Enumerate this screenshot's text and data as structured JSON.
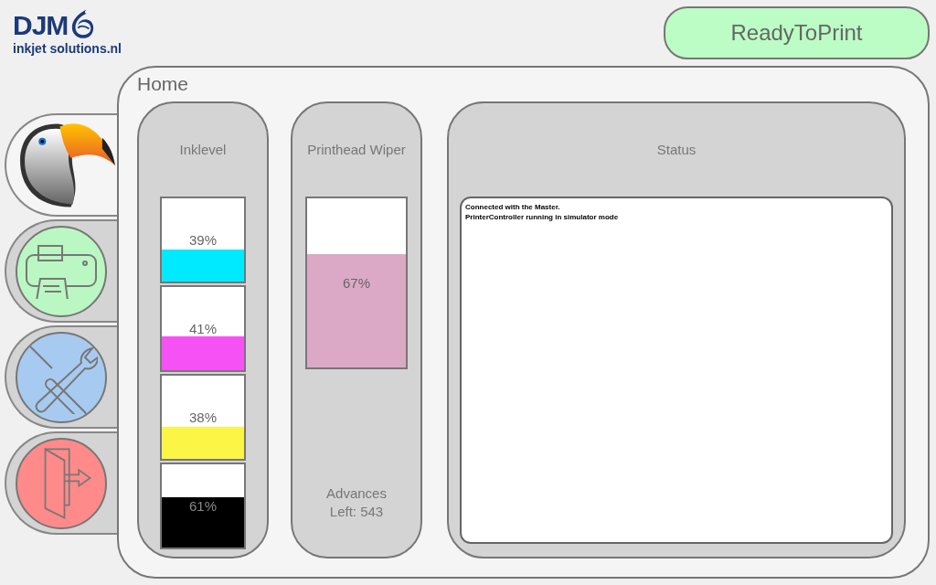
{
  "logo": {
    "brand": "DJM",
    "tagline": "inkjet solutions.nl"
  },
  "machine_state": "ReadyToPrint",
  "nav": [
    {
      "kind": "home",
      "selected": true
    },
    {
      "kind": "print",
      "selected": false
    },
    {
      "kind": "tools",
      "selected": false
    },
    {
      "kind": "exit",
      "selected": false
    }
  ],
  "page_title": "Home",
  "ink_panel": {
    "title": "Inklevel",
    "inks": [
      {
        "level": 0.39,
        "reading": "39%",
        "color": "#00eaff"
      },
      {
        "level": 0.41,
        "reading": "41%",
        "color": "#f651f4"
      },
      {
        "level": 0.38,
        "reading": "38%",
        "color": "#fbf545"
      },
      {
        "level": 0.61,
        "reading": "61%",
        "color": "#000000"
      }
    ]
  },
  "wiper_panel": {
    "title": "Printhead Wiper",
    "level": 0.67,
    "reading": "67%",
    "advances": "Advances Left: 543"
  },
  "status_panel": {
    "title": "Status",
    "log": [
      "Connected with the Master.",
      "PrinterController running in simulator mode"
    ]
  }
}
